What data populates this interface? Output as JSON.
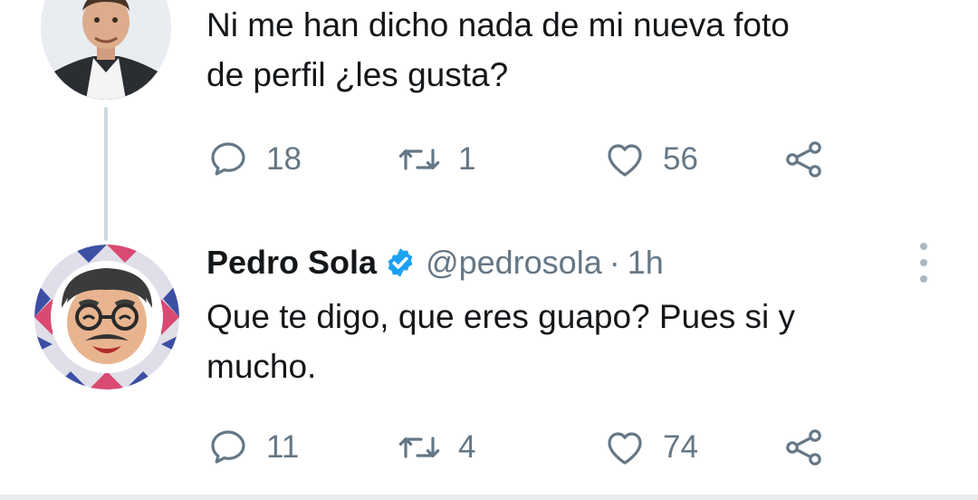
{
  "tweet1": {
    "text_line1": "Ni me han dicho nada de mi nueva foto",
    "text_line2": "de perfil ¿les gusta?",
    "replies": "18",
    "retweets": "1",
    "likes": "56"
  },
  "tweet2": {
    "name": "Pedro Sola",
    "handle": "@pedrosola",
    "separator": "·",
    "time": "1h",
    "text_line1": "Que te digo, que eres guapo? Pues si y",
    "text_line2": "mucho.",
    "replies": "11",
    "retweets": "4",
    "likes": "74"
  },
  "icons": {
    "reply": "reply-icon",
    "retweet": "retweet-icon",
    "like": "heart-icon",
    "share": "share-icon",
    "verified": "verified-badge-icon",
    "more": "more-options-icon"
  },
  "colors": {
    "text": "#14171a",
    "secondary": "#657786",
    "verified": "#1da1f2",
    "thread_line": "#cfd9de"
  }
}
